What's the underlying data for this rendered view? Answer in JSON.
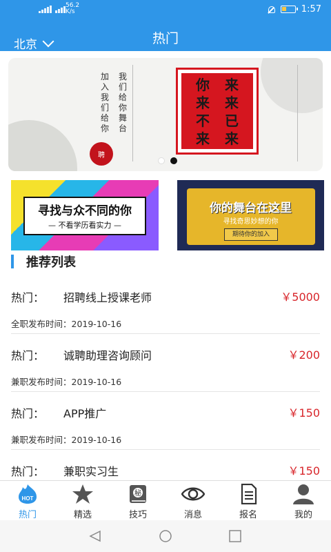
{
  "status": {
    "network_speed": "56.2",
    "network_unit": "K/s",
    "time": "1:57"
  },
  "header": {
    "city": "北京",
    "title": "热门"
  },
  "banner": {
    "seal_chars": [
      "你",
      "来",
      "来",
      "来",
      "不",
      "已",
      "来",
      "来"
    ],
    "stamp_text": "聘",
    "pages": 2,
    "active_page": 2
  },
  "promos": [
    {
      "line1": "寻找与众不同的你",
      "line2": "— 不看学历看实力 —"
    },
    {
      "line1": "你的舞台在这里",
      "line2": "寻找奇思妙想的你",
      "button": "期待你的加入"
    }
  ],
  "section_title": "推荐列表",
  "jobs": [
    {
      "tag": "热门：",
      "title": "招聘线上授课老师",
      "price": "￥5000",
      "meta": "全职发布时间：2019-10-16"
    },
    {
      "tag": "热门：",
      "title": "诚聘助理咨询顾问",
      "price": "￥200",
      "meta": "兼职发布时间：2019-10-16"
    },
    {
      "tag": "热门：",
      "title": "APP推广",
      "price": "￥150",
      "meta": "兼职发布时间：2019-10-16"
    },
    {
      "tag": "热门：",
      "title": "兼职实习生",
      "price": "￥150",
      "meta": ""
    }
  ],
  "nav": [
    {
      "label": "热门",
      "icon": "hot-flame-icon",
      "badge": "HOT",
      "active": true
    },
    {
      "label": "精选",
      "icon": "star-icon"
    },
    {
      "label": "技巧",
      "icon": "secret-book-icon",
      "badge": "秘"
    },
    {
      "label": "消息",
      "icon": "eye-icon"
    },
    {
      "label": "报名",
      "icon": "document-icon"
    },
    {
      "label": "我的",
      "icon": "user-icon"
    }
  ],
  "colors": {
    "primary": "#2f96e8",
    "price": "#d8262b",
    "seal": "#d5161f"
  }
}
